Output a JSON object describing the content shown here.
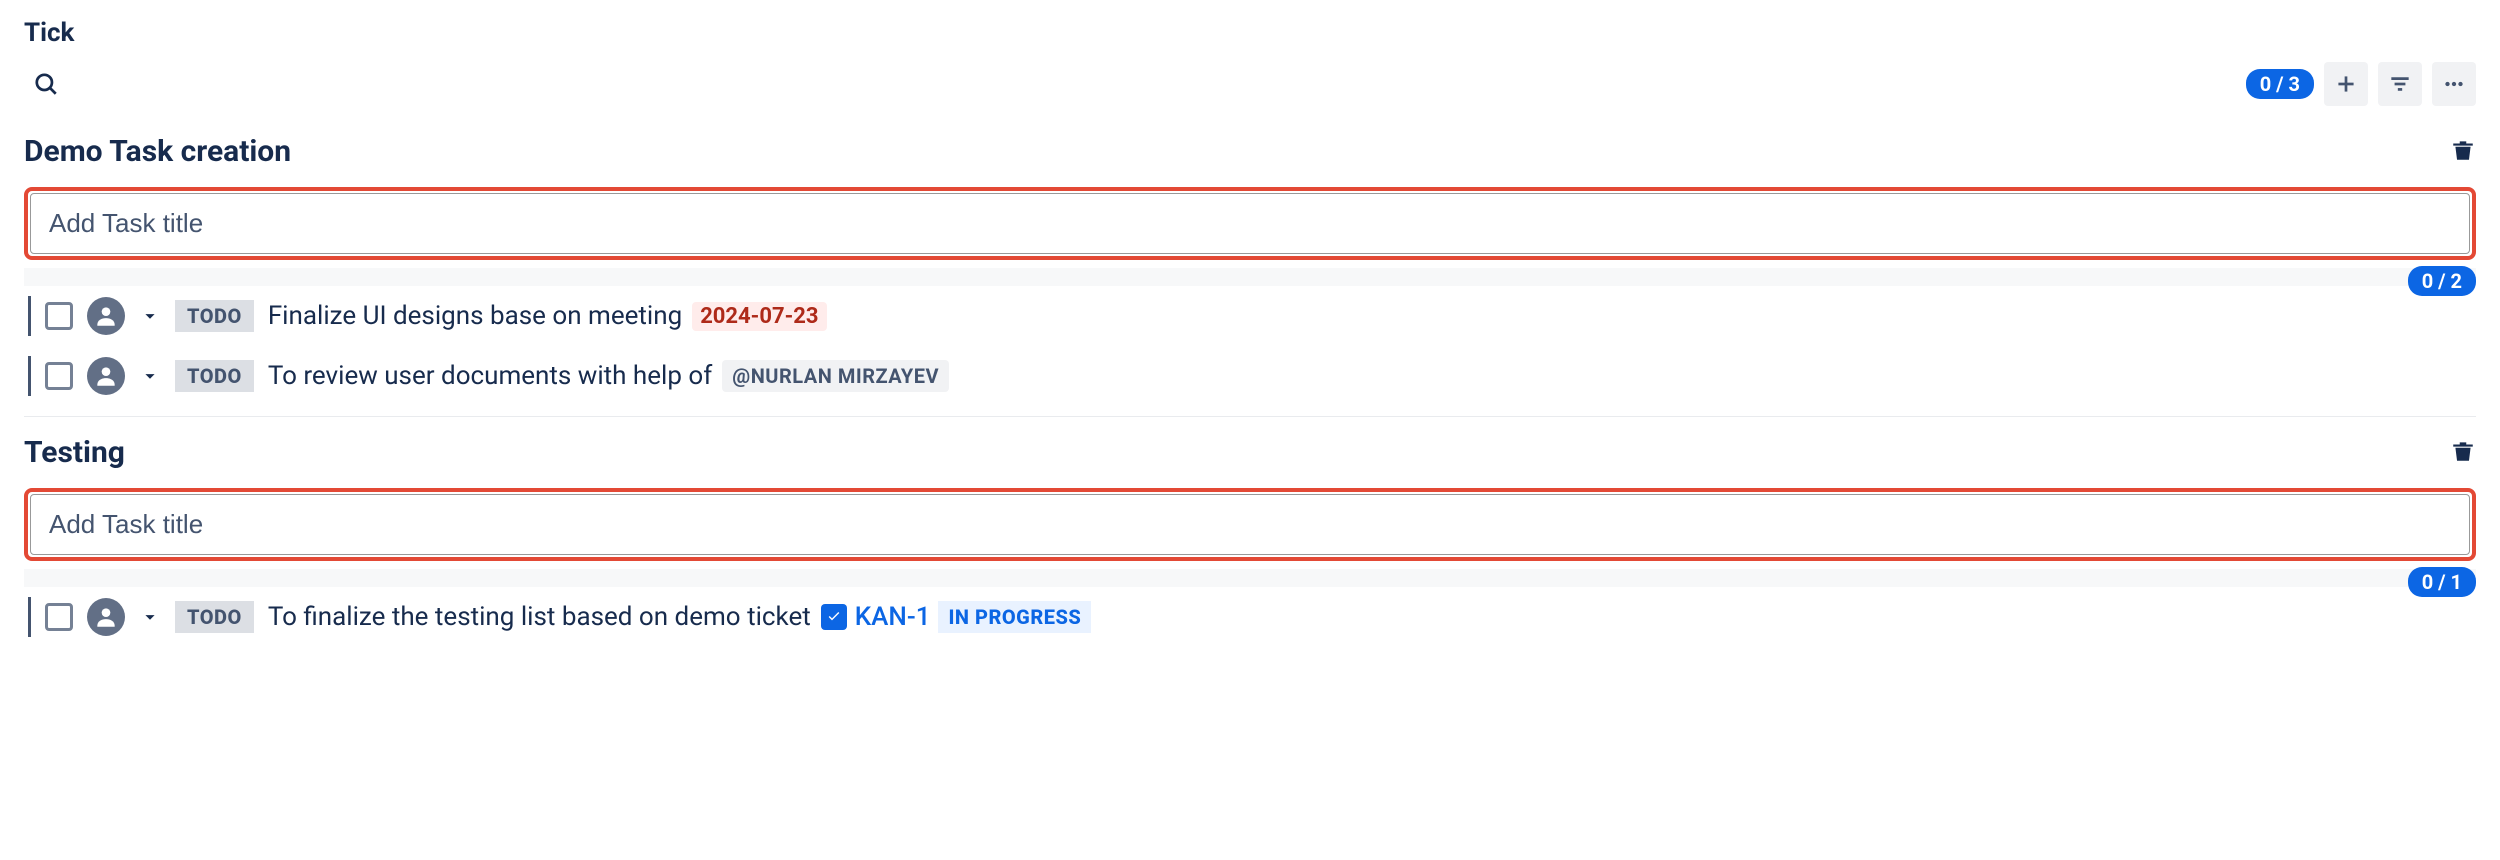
{
  "app": {
    "title": "Tick"
  },
  "toolbar": {
    "overall_count": "0 / 3"
  },
  "sections": [
    {
      "title": "Demo Task creation",
      "input_placeholder": "Add Task title",
      "count": "0 / 2",
      "tasks": [
        {
          "status": "TODO",
          "text": "Finalize UI designs base on meeting ",
          "date": "2024-07-23"
        },
        {
          "status": "TODO",
          "text": "To review user documents with help of ",
          "mention": "@NURLAN MIRZAYEV"
        }
      ]
    },
    {
      "title": "Testing",
      "input_placeholder": "Add Task title",
      "count": "0 / 1",
      "tasks": [
        {
          "status": "TODO",
          "text": "To finalize the testing list based on demo ticket ",
          "issue_key": "KAN-1",
          "issue_status": "IN PROGRESS"
        }
      ]
    }
  ]
}
